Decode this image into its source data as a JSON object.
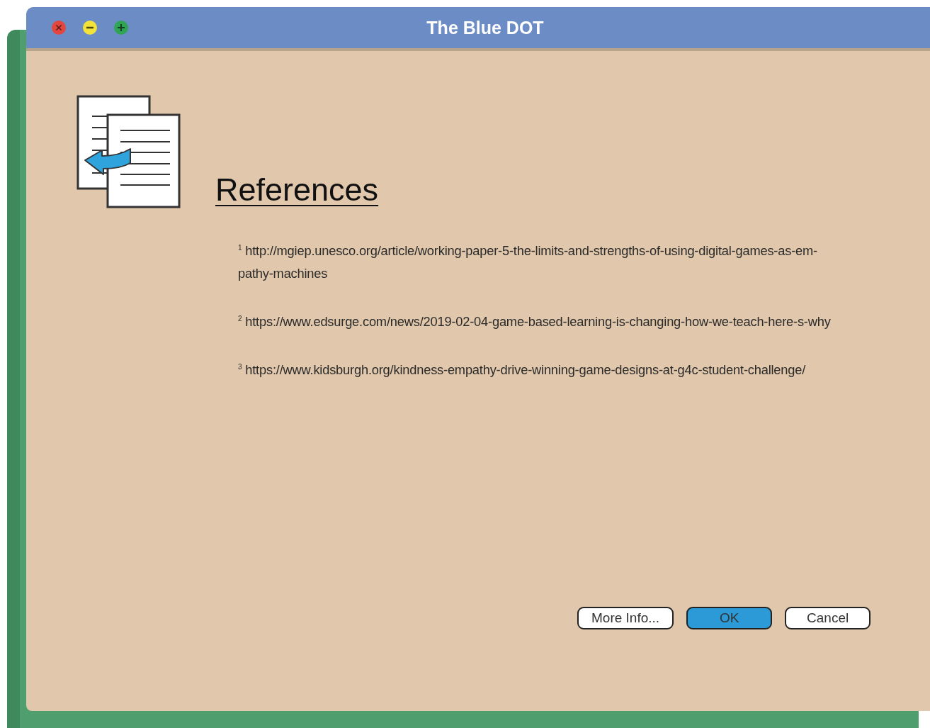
{
  "window": {
    "title": "The Blue DOT"
  },
  "heading": "References",
  "references": [
    {
      "number": "1",
      "lines": [
        "http://mgiep.unesco.org/article/working-paper-5-the-limits-and-strengths-of-using-digital-games-as-em-",
        "pathy-machines"
      ]
    },
    {
      "number": "2",
      "lines": [
        "https://www.edsurge.com/news/2019-02-04-game-based-learning-is-changing-how-we-teach-here-s-why"
      ]
    },
    {
      "number": "3",
      "lines": [
        "https://www.kidsburgh.org/kindness-empathy-drive-winning-game-designs-at-g4c-student-challenge/"
      ]
    }
  ],
  "buttons": [
    {
      "label": "More Info...",
      "default": false
    },
    {
      "label": "OK",
      "default": true
    },
    {
      "label": "Cancel",
      "default": false
    }
  ]
}
